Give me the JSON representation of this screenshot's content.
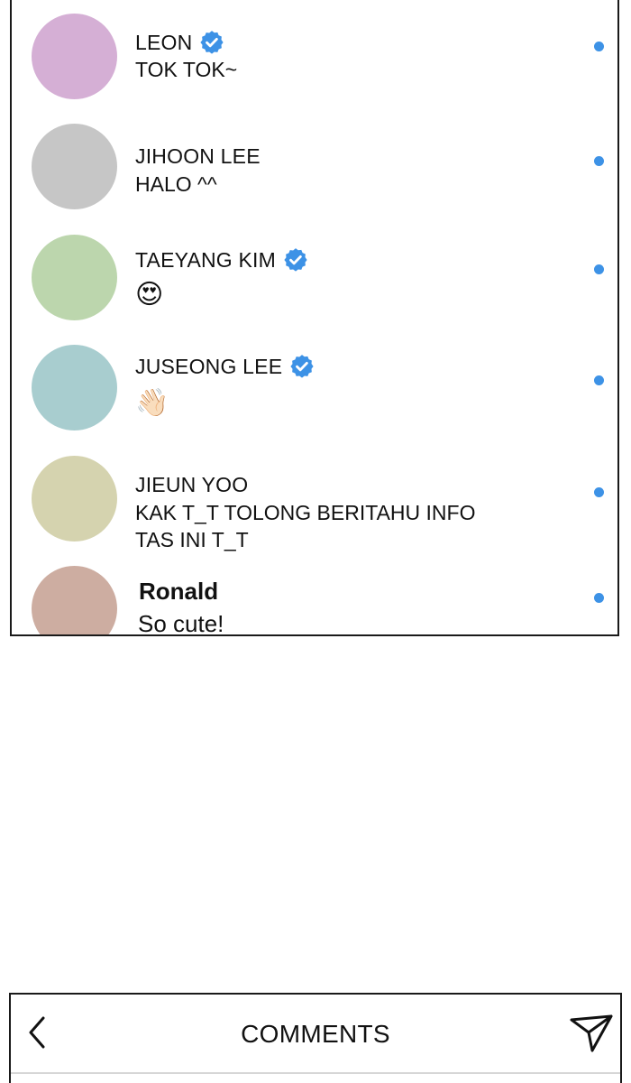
{
  "accent_color": "#3d92e6",
  "messages": [
    {
      "name": "LEON",
      "verified": true,
      "text": "TOK TOK~",
      "avatar_color": "#d5afd5",
      "unread": true
    },
    {
      "name": "JIHOON LEE",
      "verified": false,
      "text": "HALO ^^",
      "avatar_color": "#c6c6c6",
      "unread": true
    },
    {
      "name": "TAEYANG KIM",
      "verified": true,
      "text": "😍",
      "avatar_color": "#bcd6ad",
      "unread": true
    },
    {
      "name": "JUSEONG LEE",
      "verified": true,
      "text": "👋🏻",
      "avatar_color": "#a8cdcf",
      "unread": true
    },
    {
      "name": "JIEUN YOO",
      "verified": false,
      "text_lines": [
        "KAK T_T TOLONG BERITAHU INFO",
        "TAS INI T_T"
      ],
      "avatar_color": "#d5d3af",
      "unread": true
    },
    {
      "name": "Ronald",
      "verified": false,
      "text": "So cute!",
      "avatar_color": "#cdada1",
      "unread": true
    }
  ],
  "comments_bar": {
    "title": "COMMENTS",
    "back_icon": "chevron-left-icon",
    "send_icon": "paper-plane-icon"
  }
}
